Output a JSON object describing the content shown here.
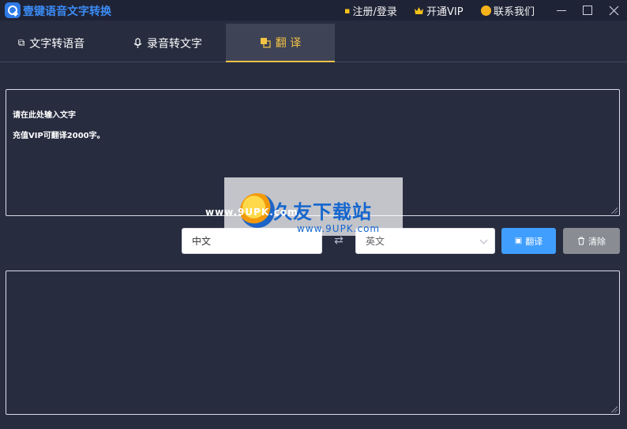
{
  "app": {
    "title": "壹键语音文字转换"
  },
  "titlebar": {
    "register": "注册/登录",
    "vip": "开通VIP",
    "contact": "联系我们"
  },
  "tabs": [
    {
      "label": "文字转语音",
      "icon": "text-icon"
    },
    {
      "label": "录音转文字",
      "icon": "microphone-icon"
    },
    {
      "label": "翻  译",
      "icon": "translate-icon",
      "active": true
    }
  ],
  "input": {
    "line1": "请在此处输入文字",
    "line2": "充值VIP可翻译2000字。"
  },
  "controls": {
    "source_lang": "中文",
    "target_lang": "英文",
    "translate_label": "翻译",
    "clear_label": "清除"
  },
  "watermark": {
    "title": "久友下载站",
    "url": "www.9UPK.com",
    "www": "www.9UPK.com"
  },
  "colors": {
    "background": "#272c3f",
    "accent": "#f3c346",
    "primary": "#409eff",
    "brand": "#3b8cf5"
  }
}
